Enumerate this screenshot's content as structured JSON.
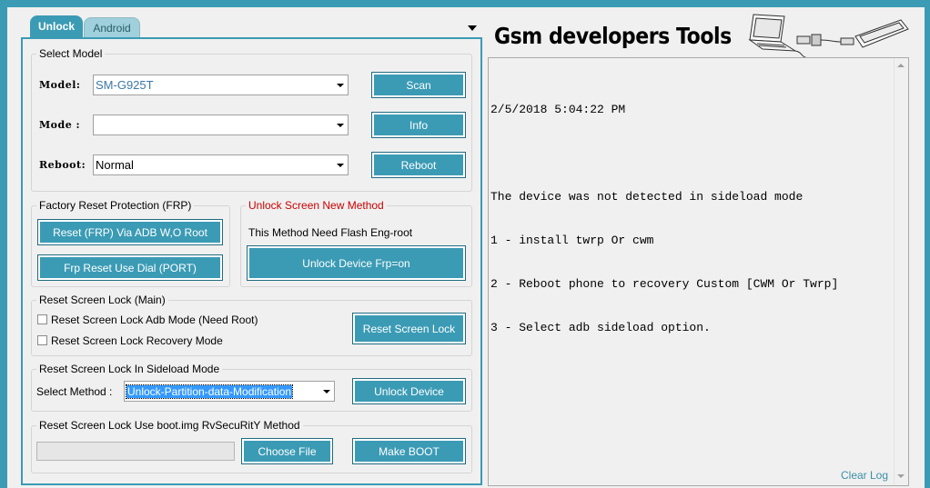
{
  "tabs": [
    {
      "label": "Unlock",
      "active": true
    },
    {
      "label": "Android",
      "active": false
    }
  ],
  "brand": {
    "title": "Gsm developers Tools"
  },
  "select_model": {
    "title": "Select Model",
    "model_label": "Model:",
    "model_value": "SM-G925T",
    "mode_label": "Mode :",
    "mode_value": "",
    "reboot_label": "Reboot:",
    "reboot_value": "Normal",
    "scan_label": "Scan",
    "info_label": "Info",
    "reboot_button_label": "Reboot"
  },
  "frp": {
    "title": "Factory Reset Protection (FRP)",
    "reset_adb_label": "Reset (FRP) Via ADB W,O Root",
    "reset_dial_label": "Frp Reset Use Dial (PORT)"
  },
  "unlock_new": {
    "title": "Unlock Screen New Method",
    "title_color": "#cc0000",
    "note": "This Method Need Flash Eng-root",
    "button_label": "Unlock Device Frp=on"
  },
  "screen_lock_main": {
    "title": "Reset Screen Lock (Main)",
    "option_adb": "Reset Screen Lock Adb Mode (Need Root)",
    "option_recovery": "Reset Screen Lock Recovery Mode",
    "button_label": "Reset Screen Lock"
  },
  "sideload": {
    "title": "Reset Screen Lock In Sideload Mode",
    "method_label": "Select Method :",
    "method_value": "Unlock-Partition-data-Modification",
    "button_label": "Unlock Device"
  },
  "bootimg": {
    "title": "Reset Screen Lock Use boot.img RvSecuRitY Method",
    "path_value": "",
    "choose_label": "Choose File",
    "make_label": "Make BOOT"
  },
  "log": {
    "lines": [
      "2/5/2018 5:04:22 PM",
      "",
      "The device was not detected in sideload mode",
      "1 - install twrp Or cwm",
      "2 - Reboot phone to recovery Custom [CWM Or Twrp]",
      "3 - Select adb sideload option."
    ],
    "clear_label": "Clear Log"
  },
  "colors": {
    "accent": "#3b9bb5",
    "link": "#3b8fa6"
  },
  "icons": [
    "dropdown-arrow-icon",
    "laptop-phone-usb-icon",
    "scroll-up-icon",
    "scroll-down-icon"
  ]
}
